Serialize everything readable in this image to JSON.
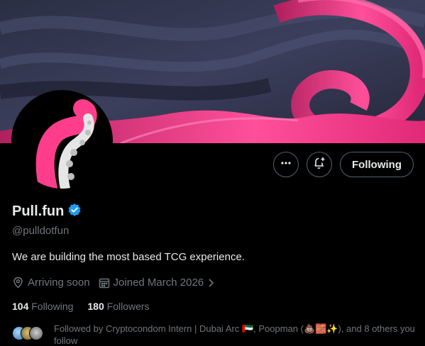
{
  "profile": {
    "display_name": "Pull.fun",
    "handle": "@pulldotfun",
    "bio": "We are building the most based TCG experience.",
    "location": "Arriving soon",
    "joined": "Joined March 2026",
    "verified": true
  },
  "actions": {
    "following_label": "Following"
  },
  "stats": {
    "following_count": "104",
    "following_label": "Following",
    "followers_count": "180",
    "followers_label": "Followers"
  },
  "followed_by": {
    "text": "Followed by Cryptocondom Intern | Dubai Arc 🇦🇪, Poopman (💩🧱✨), and 8 others you follow"
  },
  "icons": {
    "more": "more-horizontal-icon",
    "notify": "bell-plus-icon",
    "verified": "verified-badge-icon",
    "location": "location-pin-icon",
    "calendar": "calendar-icon",
    "chevron": "chevron-right-icon"
  },
  "colors": {
    "background": "#000000",
    "text_primary": "#e7e9ea",
    "text_secondary": "#71767b",
    "verified_blue": "#1d9bf0",
    "banner_pink": "#ff3d8b",
    "button_border": "#536471"
  }
}
